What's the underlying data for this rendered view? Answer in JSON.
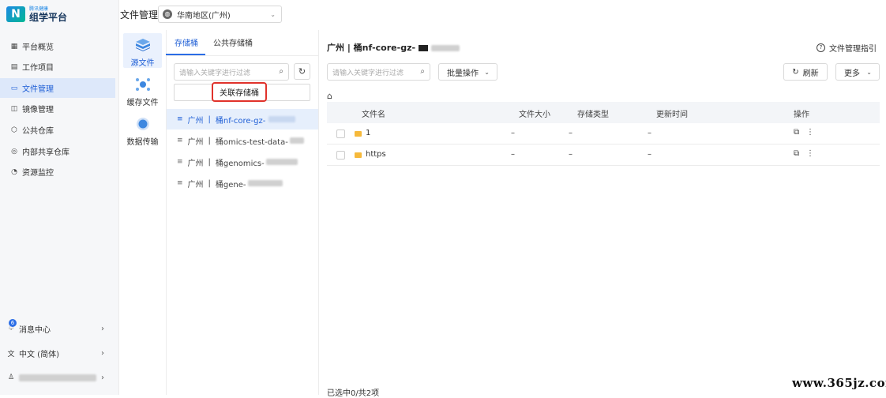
{
  "logo": {
    "mark": "N",
    "small": "腾讯健康",
    "text": "组学平台"
  },
  "sidebar": {
    "items": [
      {
        "icon": "grid-icon",
        "label": "平台概览"
      },
      {
        "icon": "calendar-icon",
        "label": "工作项目"
      },
      {
        "icon": "folder-icon",
        "label": "文件管理"
      },
      {
        "icon": "image-icon",
        "label": "镜像管理"
      },
      {
        "icon": "cube-icon",
        "label": "公共仓库"
      },
      {
        "icon": "share-icon",
        "label": "内部共享仓库"
      },
      {
        "icon": "monitor-icon",
        "label": "资源监控"
      }
    ],
    "messages": {
      "label": "消息中心",
      "badge": "6"
    },
    "language": {
      "label": "中文 (简体)"
    }
  },
  "header": {
    "title": "文件管理",
    "region": "华南地区(广州)"
  },
  "col2": {
    "items": [
      {
        "label": "源文件"
      },
      {
        "label": "缓存文件"
      },
      {
        "label": "数据传输"
      }
    ]
  },
  "bucket_panel": {
    "tabs": [
      "存储桶",
      "公共存储桶"
    ],
    "search_placeholder": "请输入关键字进行过滤",
    "link_button": "关联存储桶",
    "buckets": [
      {
        "region": "广州",
        "name": "桶nf-core-gz-"
      },
      {
        "region": "广州",
        "name": "桶omics-test-data-"
      },
      {
        "region": "广州",
        "name": "桶genomics-"
      },
      {
        "region": "广州",
        "name": "桶gene-"
      }
    ]
  },
  "main": {
    "breadcrumb": "广州 | 桶nf-core-gz-",
    "guide": "文件管理指引",
    "search_placeholder": "请输入关键字进行过滤",
    "batch": "批量操作",
    "refresh": "刷新",
    "more": "更多",
    "columns": [
      "文件名",
      "文件大小",
      "存储类型",
      "更新时间",
      "操作"
    ],
    "rows": [
      {
        "name": "1",
        "size": "–",
        "type": "–",
        "time": "–"
      },
      {
        "name": "https",
        "size": "–",
        "type": "–",
        "time": "–"
      }
    ],
    "footer": "已选中0/共2项"
  },
  "watermark": "www.365jz.com"
}
